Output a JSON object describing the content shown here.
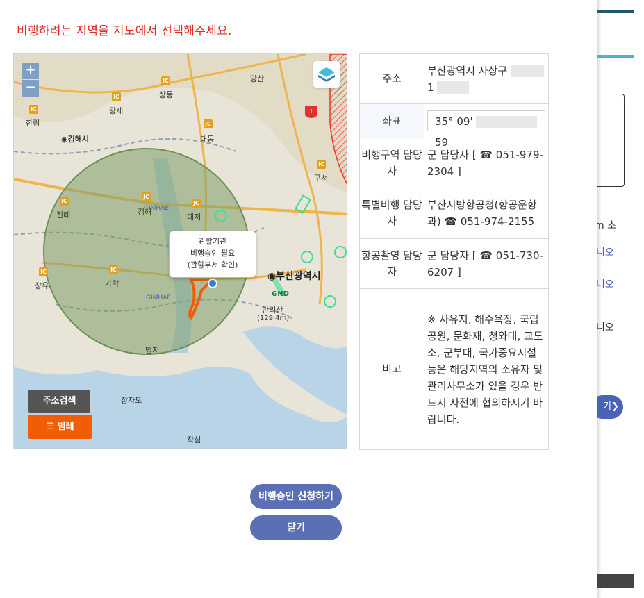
{
  "instruction": "비행하려는 지역을 지도에서 선택해주세요.",
  "map": {
    "zoom_in": "+",
    "zoom_out": "−",
    "popup_lines": [
      "관할기관",
      "비행승인 필요",
      "(관할부서 확인)"
    ],
    "address_search_label": "주소검색",
    "legend_label": "☰ 범례",
    "place_labels": {
      "yangsan": "양산",
      "sangdong": "상동",
      "gwangjae": "광재",
      "hanlim": "한림",
      "gimhaesi": "◉김해시",
      "daedong": "대동",
      "guseo": "구서",
      "gimhae": "김해",
      "daejeo": "대저",
      "busan": "◉부산광역시",
      "gaak": "가락",
      "jinye": "진례",
      "jangyu": "장유",
      "mallisan": "만리산",
      "mallisan_height": "(129.4m)",
      "myeongji": "명지",
      "jangja": "장자도",
      "jaksum": "작섬",
      "gimhae_en": "GIMHAE",
      "gnd": "GND"
    }
  },
  "info": {
    "address_label": "주소",
    "address_value_line1": "부산광역시 사상구",
    "address_value_line2": "1",
    "coord_label": "좌표",
    "coord_value_start": "35° 09'",
    "coord_value_end": "59",
    "flight_zone_label": "비행구역 담당자",
    "flight_zone_value": "군 담당자 [ ☎ 051-979-2304 ]",
    "special_flight_label": "특별비행 담당자",
    "special_flight_value": "부산지방항공청(항공운항과) ☎ 051-974-2155",
    "aerial_photo_label": "항공촬영 담당자",
    "aerial_photo_value": "군 담당자 [ ☎ 051-730-6207 ]",
    "remarks_label": "비고",
    "remarks_value": "※ 사유지, 해수욕장, 국립공원, 문화재, 청와대, 교도소, 군부대, 국가중요시설 등은 해당지역의 소유자 및 관리사무소가 있을 경우 반드시 사전에 협의하시기 바랍니다."
  },
  "buttons": {
    "apply": "비행승인 신청하기",
    "close": "닫기"
  },
  "background": {
    "text_m": "m 초",
    "text_nio1": "니오",
    "text_nio2": "니오",
    "text_nio3": "니오",
    "btn_text": "기❯"
  }
}
